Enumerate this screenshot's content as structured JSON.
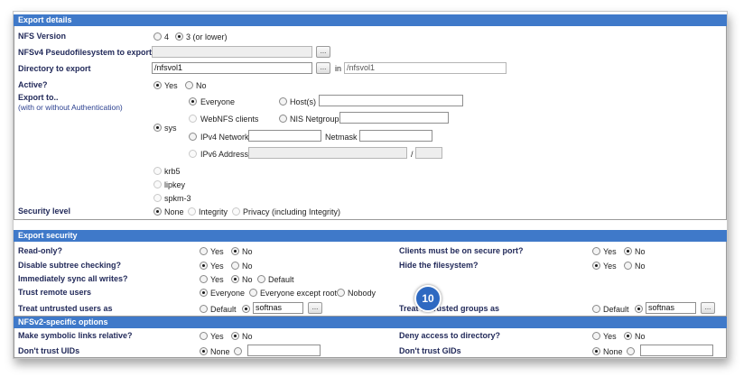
{
  "export_details": {
    "header": "Export details",
    "nfs_version": {
      "label": "NFS Version",
      "options": [
        "4",
        "3 (or lower)"
      ]
    },
    "pseudofs": {
      "label": "NFSv4 Pseudofilesystem to export",
      "value": "",
      "button": "..."
    },
    "directory": {
      "label": "Directory to export",
      "value": "/nfsvol1",
      "button": "...",
      "in_label": "in",
      "in_value": "/nfsvol1"
    },
    "active": {
      "label": "Active?",
      "yes": "Yes",
      "no": "No"
    },
    "export_to": {
      "label": "Export to..",
      "sublabel": "(with or without Authentication)",
      "sys": "sys",
      "everyone": "Everyone",
      "hosts": "Host(s)",
      "webnfs": "WebNFS clients",
      "netgroup": "NIS Netgroup",
      "ipv4": "IPv4 Network",
      "netmask": "Netmask",
      "ipv6": "IPv6 Address",
      "slash": "/",
      "krb5": "krb5",
      "lipkey": "lipkey",
      "spkm3": "spkm-3"
    },
    "security_level": {
      "label": "Security level",
      "none": "None",
      "integrity": "Integrity",
      "privacy": "Privacy (including Integrity)"
    }
  },
  "export_security": {
    "header": "Export security",
    "read_only": {
      "label": "Read-only?",
      "yes": "Yes",
      "no": "No"
    },
    "secure_port": {
      "label": "Clients must be on secure port?",
      "yes": "Yes",
      "no": "No"
    },
    "subtree": {
      "label": "Disable subtree checking?",
      "yes": "Yes",
      "no": "No"
    },
    "hide_fs": {
      "label": "Hide the filesystem?",
      "yes": "Yes",
      "no": "No"
    },
    "sync": {
      "label": "Immediately sync all writes?",
      "yes": "Yes",
      "no": "No",
      "default": "Default"
    },
    "trust_remote": {
      "label": "Trust remote users",
      "everyone": "Everyone",
      "except_root": "Everyone except root",
      "nobody": "Nobody"
    },
    "untrusted_users": {
      "label": "Treat untrusted users as",
      "default": "Default",
      "value": "softnas",
      "button": "..."
    },
    "untrusted_groups": {
      "label": "Treat untrusted groups as",
      "default": "Default",
      "value": "softnas",
      "button": "..."
    }
  },
  "nfsv2": {
    "header": "NFSv2-specific options",
    "symlinks": {
      "label": "Make symbolic links relative?",
      "yes": "Yes",
      "no": "No"
    },
    "deny_dir": {
      "label": "Deny access to directory?",
      "yes": "Yes",
      "no": "No"
    },
    "uids": {
      "label": "Don't trust UIDs",
      "none": "None",
      "value": ""
    },
    "gids": {
      "label": "Don't trust GIDs",
      "none": "None",
      "value": ""
    }
  },
  "callout": {
    "number": "10"
  }
}
